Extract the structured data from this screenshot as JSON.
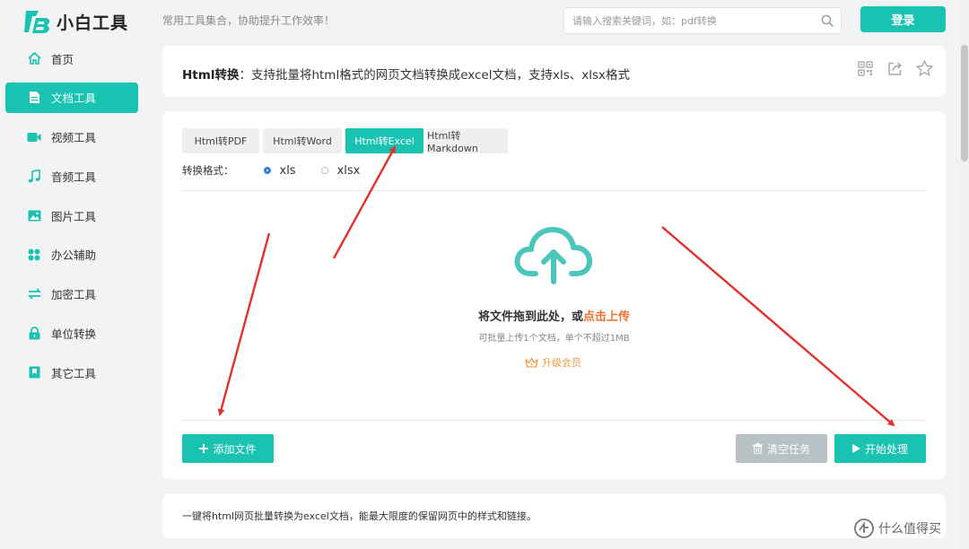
{
  "header": {
    "logo_text": "小白工具",
    "slogan": "常用工具集合，协助提升工作效率！",
    "search_placeholder": "请输入搜索关键词，如：pdf转换",
    "login_label": "登录"
  },
  "sidebar": {
    "items": [
      {
        "label": "首页",
        "icon": "home-icon"
      },
      {
        "label": "文档工具",
        "icon": "document-icon",
        "active": true
      },
      {
        "label": "视频工具",
        "icon": "video-icon"
      },
      {
        "label": "音频工具",
        "icon": "music-icon"
      },
      {
        "label": "图片工具",
        "icon": "image-icon"
      },
      {
        "label": "办公辅助",
        "icon": "grid-icon"
      },
      {
        "label": "加密工具",
        "icon": "swap-icon"
      },
      {
        "label": "单位转换",
        "icon": "lock-icon"
      },
      {
        "label": "其它工具",
        "icon": "bookmark-icon"
      }
    ]
  },
  "title_card": {
    "title_bold": "Html转换",
    "title_rest": "：支持批量将html格式的网页文档转换成excel文档，支持xls、xlsx格式"
  },
  "tabs": [
    {
      "label": "Html转PDF"
    },
    {
      "label": "Html转Word"
    },
    {
      "label": "Html转Excel",
      "active": true
    },
    {
      "label": "Html转Markdown"
    }
  ],
  "format": {
    "label": "转换格式：",
    "options": [
      {
        "label": "xls",
        "selected": true
      },
      {
        "label": "xlsx",
        "selected": false
      }
    ]
  },
  "upload": {
    "drop_text": "将文件拖到此处，或",
    "drop_link": "点击上传",
    "sub_text": "可批量上传1个文档，单个不超过1MB",
    "upgrade_label": "升级会员"
  },
  "actions": {
    "add_label": "添加文件",
    "clear_label": "清空任务",
    "start_label": "开始处理"
  },
  "description": "一键将html网页批量转换为excel文档，能最大限度的保留网页中的样式和链接。",
  "watermark": "什么值得买",
  "colors": {
    "accent": "#19c2b1",
    "link": "#f0712e",
    "upgrade": "#f09a3f",
    "disabled": "#b7c1c6",
    "annotation_arrow": "#e5302a"
  }
}
